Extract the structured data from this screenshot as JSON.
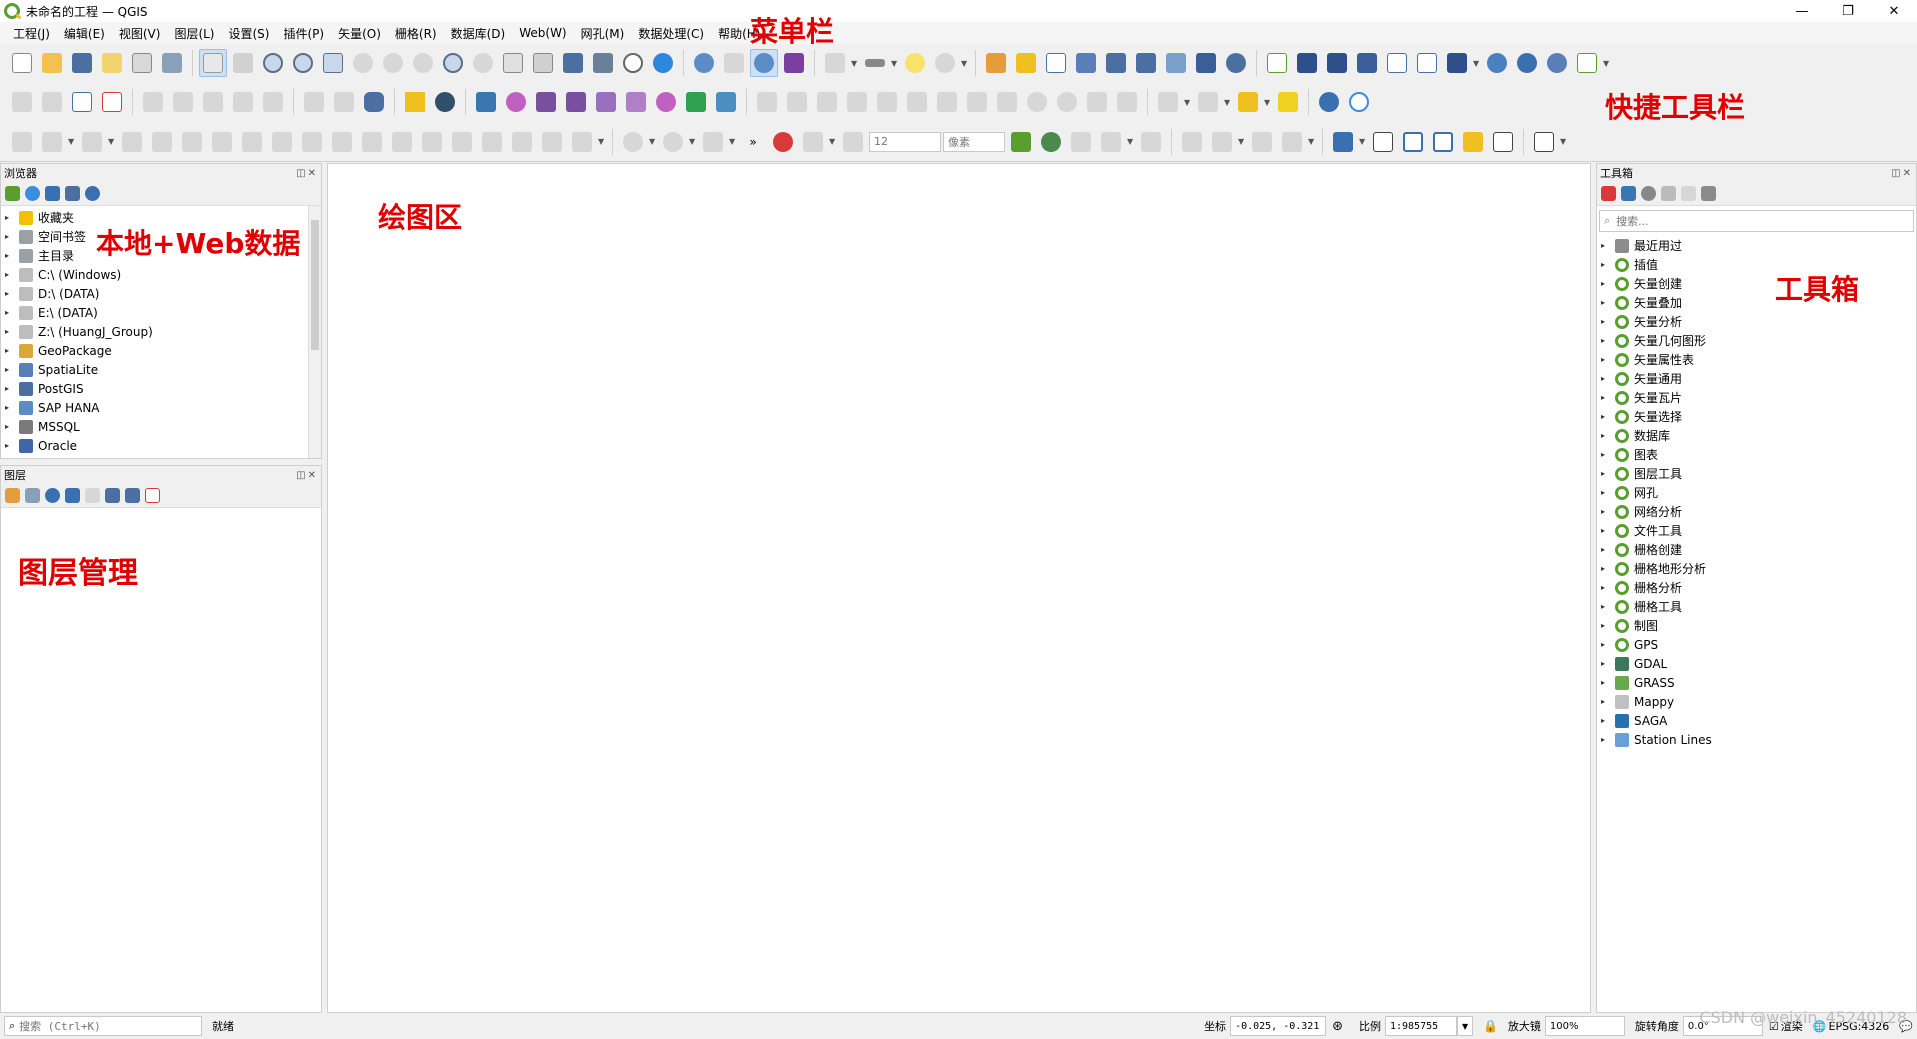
{
  "window": {
    "title": "未命名的工程 — QGIS",
    "controls": [
      "—",
      "❐",
      "✕"
    ]
  },
  "menubar": {
    "items": [
      "工程(J)",
      "编辑(E)",
      "视图(V)",
      "图层(L)",
      "设置(S)",
      "插件(P)",
      "矢量(O)",
      "栅格(R)",
      "数据库(D)",
      "Web(W)",
      "网孔(M)",
      "数据处理(C)",
      "帮助(H)"
    ]
  },
  "annotations": {
    "menubar": "菜单栏",
    "toolbar": "快捷工具栏",
    "browser": "本地+Web数据",
    "canvas": "绘图区",
    "layers": "图层管理",
    "toolbox": "工具箱"
  },
  "toolbar3": {
    "size_value": "12",
    "unit_value": "像素"
  },
  "browser": {
    "title": "浏览器",
    "items": [
      {
        "label": "收藏夹",
        "icon": "star-icon",
        "color": "#f2c200"
      },
      {
        "label": "空间书签",
        "icon": "bookmark-icon",
        "color": "#9aa0a6"
      },
      {
        "label": "主目录",
        "icon": "home-folder-icon",
        "color": "#9aa0a6"
      },
      {
        "label": "C:\\ (Windows)",
        "icon": "drive-icon",
        "color": "#bdbdbd"
      },
      {
        "label": "D:\\ (DATA)",
        "icon": "drive-icon",
        "color": "#bdbdbd"
      },
      {
        "label": "E:\\ (DATA)",
        "icon": "drive-icon",
        "color": "#bdbdbd"
      },
      {
        "label": "Z:\\ (HuangJ_Group)",
        "icon": "drive-icon",
        "color": "#bdbdbd"
      },
      {
        "label": "GeoPackage",
        "icon": "geopackage-icon",
        "color": "#d8a838"
      },
      {
        "label": "SpatiaLite",
        "icon": "spatialite-icon",
        "color": "#5a7fb8"
      },
      {
        "label": "PostGIS",
        "icon": "postgis-icon",
        "color": "#4a6fa0"
      },
      {
        "label": "SAP HANA",
        "icon": "sap-hana-icon",
        "color": "#5b8cc8"
      },
      {
        "label": "MSSQL",
        "icon": "mssql-icon",
        "color": "#7a7a7a"
      },
      {
        "label": "Oracle",
        "icon": "oracle-icon",
        "color": "#3f66a8"
      }
    ]
  },
  "layers": {
    "title": "图层"
  },
  "toolbox": {
    "title": "工具箱",
    "search_placeholder": "搜索...",
    "items": [
      {
        "label": "最近用过",
        "icon": "clock-icon",
        "color": "#8c8c8c"
      },
      {
        "label": "插值",
        "icon": "qgis-icon",
        "color": "#5a9e2f"
      },
      {
        "label": "矢量创建",
        "icon": "qgis-icon",
        "color": "#5a9e2f"
      },
      {
        "label": "矢量叠加",
        "icon": "qgis-icon",
        "color": "#5a9e2f"
      },
      {
        "label": "矢量分析",
        "icon": "qgis-icon",
        "color": "#5a9e2f"
      },
      {
        "label": "矢量几何图形",
        "icon": "qgis-icon",
        "color": "#5a9e2f"
      },
      {
        "label": "矢量属性表",
        "icon": "qgis-icon",
        "color": "#5a9e2f"
      },
      {
        "label": "矢量通用",
        "icon": "qgis-icon",
        "color": "#5a9e2f"
      },
      {
        "label": "矢量瓦片",
        "icon": "qgis-icon",
        "color": "#5a9e2f"
      },
      {
        "label": "矢量选择",
        "icon": "qgis-icon",
        "color": "#5a9e2f"
      },
      {
        "label": "数据库",
        "icon": "qgis-icon",
        "color": "#5a9e2f"
      },
      {
        "label": "图表",
        "icon": "qgis-icon",
        "color": "#5a9e2f"
      },
      {
        "label": "图层工具",
        "icon": "qgis-icon",
        "color": "#5a9e2f"
      },
      {
        "label": "网孔",
        "icon": "qgis-icon",
        "color": "#5a9e2f"
      },
      {
        "label": "网络分析",
        "icon": "qgis-icon",
        "color": "#5a9e2f"
      },
      {
        "label": "文件工具",
        "icon": "qgis-icon",
        "color": "#5a9e2f"
      },
      {
        "label": "栅格创建",
        "icon": "qgis-icon",
        "color": "#5a9e2f"
      },
      {
        "label": "栅格地形分析",
        "icon": "qgis-icon",
        "color": "#5a9e2f"
      },
      {
        "label": "栅格分析",
        "icon": "qgis-icon",
        "color": "#5a9e2f"
      },
      {
        "label": "栅格工具",
        "icon": "qgis-icon",
        "color": "#5a9e2f"
      },
      {
        "label": "制图",
        "icon": "qgis-icon",
        "color": "#5a9e2f"
      },
      {
        "label": "GPS",
        "icon": "qgis-icon",
        "color": "#5a9e2f"
      },
      {
        "label": "GDAL",
        "icon": "gdal-icon",
        "color": "#3a7a5a"
      },
      {
        "label": "GRASS",
        "icon": "grass-icon",
        "color": "#6aa84f"
      },
      {
        "label": "Mappy",
        "icon": "mappy-icon",
        "color": "#c0c0c0"
      },
      {
        "label": "SAGA",
        "icon": "saga-icon",
        "color": "#2a6fb0"
      },
      {
        "label": "Station Lines",
        "icon": "station-lines-icon",
        "color": "#6aa0d8"
      }
    ]
  },
  "statusbar": {
    "search_placeholder": "搜索 (Ctrl+K)",
    "status": "就绪",
    "coord_label": "坐标",
    "coord_value": "-0.025, -0.321",
    "scale_label": "比例",
    "scale_value": "1:985755",
    "magnifier_label": "放大镜",
    "magnifier_value": "100%",
    "rotation_label": "旋转角度",
    "rotation_value": "0.0°",
    "render_label": "渲染",
    "crs": "EPSG:4326",
    "watermark": "CSDN @weixin_45240128"
  }
}
